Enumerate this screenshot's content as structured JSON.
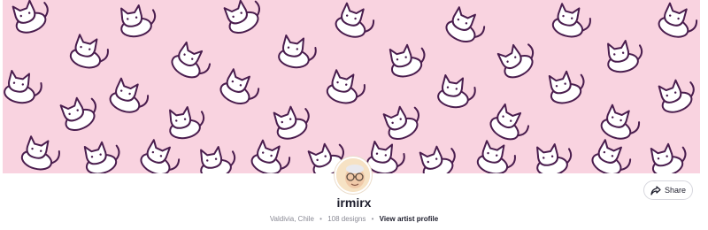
{
  "profile": {
    "username": "irmirx",
    "location": "Valdivia, Chile",
    "designs": "108 designs",
    "separator": "•",
    "view_profile": "View artist profile"
  },
  "actions": {
    "share_label": "Share"
  },
  "banner": {
    "pattern": "cat-pattern",
    "background_color": "#f9d3e0",
    "outline_color": "#4a1d4e"
  },
  "avatar": {
    "icon": "bald-man-with-glasses-avatar"
  }
}
